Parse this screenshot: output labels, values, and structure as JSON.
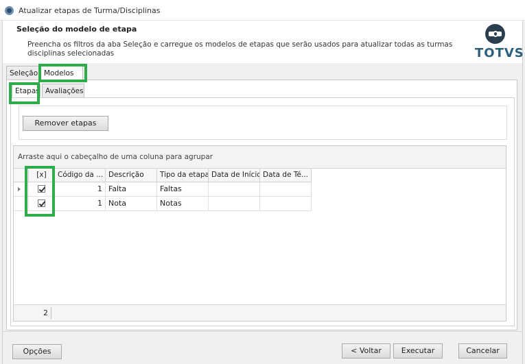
{
  "window": {
    "title": "Atualizar etapas de Turma/Disciplinas"
  },
  "header": {
    "title": "Seleção do modelo de etapa",
    "description": "Preencha os filtros da aba Seleção e carregue os modelos de etapas que serão usados para atualizar todas as turmas disciplinas selecionadas",
    "logo_text": "TOTVS"
  },
  "tabs": [
    {
      "label": "Seleção",
      "active": false
    },
    {
      "label": "Modelos",
      "active": true
    }
  ],
  "inner_tabs": [
    {
      "label": "Etapas",
      "active": true
    },
    {
      "label": "Avaliações",
      "active": false
    }
  ],
  "toolbar": {
    "remove_label": "Remover etapas"
  },
  "grid": {
    "group_hint": "Arraste aqui o cabeçalho de uma coluna para agrupar",
    "columns": [
      "[x]",
      "Código da ...",
      "Descrição",
      "Tipo da etapa",
      "Data de Início",
      "Data de Té..."
    ],
    "rows": [
      {
        "checked": true,
        "codigo": "1",
        "descricao": "Falta",
        "tipo": "Faltas",
        "inicio": "",
        "termino": ""
      },
      {
        "checked": true,
        "codigo": "1",
        "descricao": "Nota",
        "tipo": "Notas",
        "inicio": "",
        "termino": ""
      }
    ],
    "footer_count": "2"
  },
  "footer": {
    "options_label": "Opções",
    "back_label": "< Voltar",
    "execute_label": "Executar",
    "cancel_label": "Cancelar"
  },
  "colors": {
    "highlight": "#2dac4a",
    "logo": "#2b5f7a"
  }
}
